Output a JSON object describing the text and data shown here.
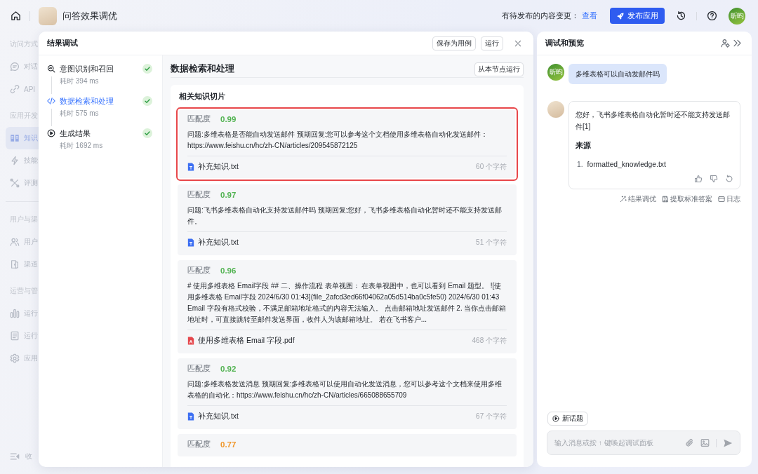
{
  "top_bar": {
    "title": "问答效果调优",
    "notice": "有待发布的内容变更：",
    "notice_link": "查看",
    "publish_button": "发布应用",
    "user_avatar": "昕昀"
  },
  "sidebar": {
    "groups": [
      {
        "sections": [
          {
            "title": "访问方式",
            "items": [
              {
                "label": "对话",
                "selected": false
              },
              {
                "label": "API",
                "selected": false
              }
            ]
          },
          {
            "title": "应用开发",
            "items": [
              {
                "label": "知识",
                "selected": true
              },
              {
                "label": "技能",
                "selected": false
              },
              {
                "label": "评测",
                "selected": false
              }
            ]
          }
        ]
      },
      {
        "sections": [
          {
            "title": "用户与渠",
            "items": [
              {
                "label": "用户",
                "selected": false
              },
              {
                "label": "渠道",
                "selected": false
              }
            ]
          },
          {
            "title": "运营与管",
            "items": [
              {
                "label": "运行",
                "selected": false
              },
              {
                "label": "运行",
                "selected": false
              },
              {
                "label": "应用",
                "selected": false
              }
            ]
          }
        ]
      }
    ],
    "collapse": "收"
  },
  "debug_panel": {
    "title": "结果调试",
    "buttons": [
      "保存为用例",
      "运行"
    ],
    "steps": [
      {
        "title": "意图识别和召回",
        "duration": "耗时 394 ms",
        "selected": false,
        "done": true
      },
      {
        "title": "数据检索和处理",
        "duration": "耗时 575 ms",
        "selected": true,
        "done": true
      },
      {
        "title": "生成结果",
        "duration": "耗时 1692 ms",
        "selected": false,
        "done": true
      }
    ],
    "detail": {
      "title": "数据检索和处理",
      "run_button": "从本节点运行",
      "section_title": "相关知识切片",
      "chunks": [
        {
          "score_label": "匹配度",
          "score": "0.99",
          "color": "#52b352",
          "highlighted": true,
          "text": "问题:多维表格是否能自动发送邮件 预期回复:您可以参考这个文档使用多维表格自动化发送邮件：https://www.feishu.cn/hc/zh-CN/articles/209545872125",
          "file": {
            "name": "补充知识.txt",
            "kind": "txt"
          },
          "length": "60 个字符"
        },
        {
          "score_label": "匹配度",
          "score": "0.97",
          "color": "#52b352",
          "highlighted": false,
          "text": "问题:飞书多维表格自动化支持发送邮件吗 预期回复:您好，飞书多维表格自动化暂时还不能支持发送邮件。",
          "file": {
            "name": "补充知识.txt",
            "kind": "txt"
          },
          "length": "51 个字符"
        },
        {
          "score_label": "匹配度",
          "score": "0.96",
          "color": "#52b352",
          "highlighted": false,
          "text": "# 使用多维表格 Email字段 ## 二、操作流程 表单视图： 在表单视图中，也可以看到 Email 题型。 ![使用多维表格 Email字段 2024/6/30 01:43](file_2afcd3ed66f04062a05d514ba0c5fe50) 2024/6/30 01:43 Email 字段有格式校验，不满足邮箱地址格式的内容无法输入。 点击邮箱地址发送邮件 2. 当你点击邮箱地址时，可直接跳转至邮件发送界面，收件人为该邮箱地址。 若在飞书客户...",
          "file": {
            "name": "使用多维表格 Email 字段.pdf",
            "kind": "pdf"
          },
          "length": "468 个字符"
        },
        {
          "score_label": "匹配度",
          "score": "0.92",
          "color": "#52b352",
          "highlighted": false,
          "text": "问题:多维表格发送消息 预期回复:多维表格可以使用自动化发送消息，您可以参考这个文档来使用多维表格的自动化：https://www.feishu.cn/hc/zh-CN/articles/665088655709",
          "file": {
            "name": "补充知识.txt",
            "kind": "txt"
          },
          "length": "67 个字符"
        },
        {
          "score_label": "匹配度",
          "score": "0.77",
          "color": "#f0962a",
          "highlighted": false
        }
      ]
    }
  },
  "preview_panel": {
    "title": "调试和预览",
    "messages": [
      {
        "kind": "user",
        "avatar": "昕昀",
        "text": "多维表格可以自动发邮件吗"
      },
      {
        "kind": "assistant",
        "text": "您好，飞书多维表格自动化暂时还不能支持发送邮件[1]",
        "sources_title": "来源",
        "sources": [
          {
            "number": "1.",
            "name": "formatted_knowledge.txt"
          }
        ],
        "actions": [
          "结果调优",
          "提取标准答案",
          "日志"
        ]
      }
    ],
    "new_topic": "新话题",
    "input": {
      "placeholder": "输入消息或按 ↑ 键唤起调试面板"
    }
  }
}
